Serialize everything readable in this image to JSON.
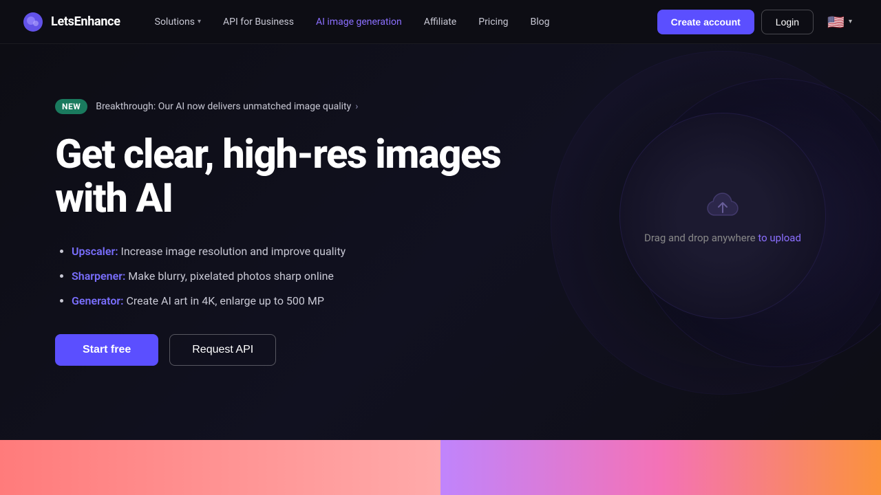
{
  "nav": {
    "logo_text": "LetsEnhance",
    "links": [
      {
        "label": "Solutions",
        "has_chevron": true,
        "ai": false
      },
      {
        "label": "API for Business",
        "has_chevron": false,
        "ai": false
      },
      {
        "label": "AI image generation",
        "has_chevron": false,
        "ai": true
      },
      {
        "label": "Affiliate",
        "has_chevron": false,
        "ai": false
      },
      {
        "label": "Pricing",
        "has_chevron": false,
        "ai": false
      },
      {
        "label": "Blog",
        "has_chevron": false,
        "ai": false
      }
    ],
    "create_account": "Create account",
    "login": "Login",
    "lang_flag": "🇺🇸",
    "lang_chevron": "▾"
  },
  "hero": {
    "badge_new": "NEW",
    "badge_text": "Breakthrough: Our AI now delivers unmatched image quality",
    "title": "Get clear, high-res images with AI",
    "features": [
      {
        "link": "Upscaler:",
        "text": " Increase image resolution and improve quality"
      },
      {
        "link": "Sharpener:",
        "text": " Make blurry, pixelated photos sharp online"
      },
      {
        "link": "Generator:",
        "text": " Create AI art in 4K, enlarge up to 500 MP"
      }
    ],
    "btn_start_free": "Start free",
    "btn_request_api": "Request API",
    "upload_text": "Drag and drop anywhere",
    "upload_link": "to upload",
    "upload_icon": "☁"
  }
}
